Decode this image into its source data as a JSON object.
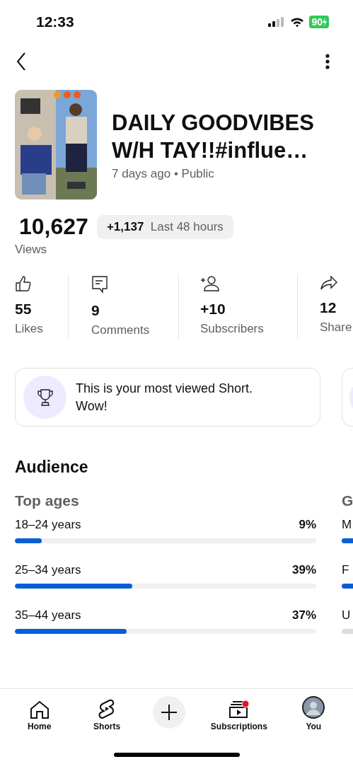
{
  "status_bar": {
    "time": "12:33",
    "battery": "90"
  },
  "video": {
    "kind": "picture",
    "title": "DAILY GOODVIBES W/H TAY!!#influe…",
    "age": "7 days ago",
    "separator": "•",
    "visibility": "Public"
  },
  "views": {
    "count": "10,627",
    "label": "Views",
    "delta": "+1,137",
    "period": "Last 48 hours"
  },
  "stats": [
    {
      "kind": "likes",
      "value": "55",
      "label": "Likes"
    },
    {
      "kind": "comments",
      "value": "9",
      "label": "Comments"
    },
    {
      "kind": "subscribers",
      "value": "+10",
      "label": "Subscribers"
    },
    {
      "kind": "shares",
      "value": "12",
      "label": "Share"
    }
  ],
  "milestone": {
    "text": "This is your most viewed Short. Wow!"
  },
  "audience": {
    "title": "Audience",
    "top_ages": {
      "title": "Top ages",
      "rows": [
        {
          "label": "18–24 years",
          "value": "9%",
          "level": 0.09
        },
        {
          "label": "25–34 years",
          "value": "39%",
          "level": 0.39
        },
        {
          "label": "35–44 years",
          "value": "37%",
          "level": 0.37
        }
      ]
    },
    "column_2": {
      "title": "G",
      "rows": [
        {
          "label": "M",
          "bar_started": true
        },
        {
          "label": "F",
          "bar_started": true
        },
        {
          "label": "U",
          "bar_started": false
        }
      ]
    }
  },
  "bottom_nav": [
    {
      "kind": "home",
      "label": "Home"
    },
    {
      "kind": "shorts",
      "label": "Shorts"
    },
    {
      "kind": "create"
    },
    {
      "kind": "subscriptions",
      "label": "Subscriptions",
      "notification": true
    },
    {
      "kind": "you",
      "label": "You"
    }
  ]
}
